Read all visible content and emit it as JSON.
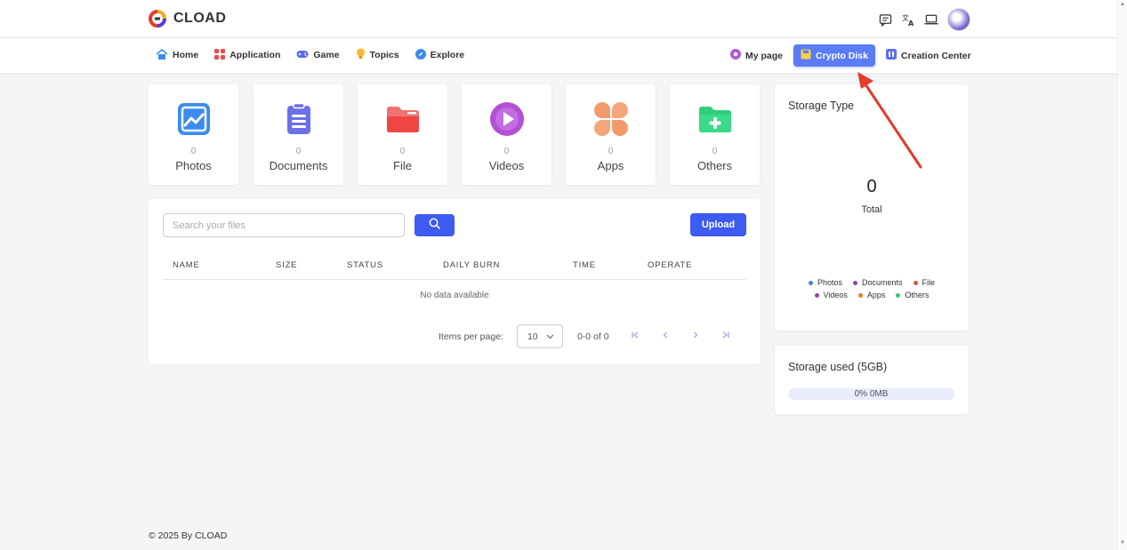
{
  "app": {
    "name": "CLOAD"
  },
  "header": {
    "icons": [
      "message-icon",
      "translate-icon",
      "laptop-icon",
      "avatar"
    ]
  },
  "nav": {
    "left": [
      {
        "label": "Home",
        "icon": "home-icon"
      },
      {
        "label": "Application",
        "icon": "apps-grid-icon"
      },
      {
        "label": "Game",
        "icon": "gamepad-icon"
      },
      {
        "label": "Topics",
        "icon": "bulb-icon"
      },
      {
        "label": "Explore",
        "icon": "compass-icon"
      }
    ],
    "right": [
      {
        "label": "My page",
        "icon": "flower-icon"
      },
      {
        "label": "Crypto Disk",
        "icon": "disk-icon",
        "active": true
      },
      {
        "label": "Creation Center",
        "icon": "grid-icon"
      }
    ]
  },
  "categories": [
    {
      "label": "Photos",
      "count": "0",
      "color": "#3b8bf0"
    },
    {
      "label": "Documents",
      "count": "0",
      "color": "#6b6fe8"
    },
    {
      "label": "File",
      "count": "0",
      "color": "#f05252"
    },
    {
      "label": "Videos",
      "count": "0",
      "color": "#b44fd6"
    },
    {
      "label": "Apps",
      "count": "0",
      "color": "#f29a6a"
    },
    {
      "label": "Others",
      "count": "0",
      "color": "#2fcf7a"
    }
  ],
  "files": {
    "search_placeholder": "Search your files",
    "upload_label": "Upload",
    "columns": [
      "NAME",
      "SIZE",
      "STATUS",
      "DAILY BURN",
      "TIME",
      "OPERATE"
    ],
    "empty_text": "No data available",
    "pager": {
      "items_per_page_label": "Items per page:",
      "per_page": "10",
      "range": "0-0 of 0"
    }
  },
  "storage_type": {
    "title": "Storage Type",
    "total": "0",
    "total_label": "Total",
    "legend": [
      {
        "label": "Photos",
        "color": "#4a80c8"
      },
      {
        "label": "Documents",
        "color": "#8e44ad"
      },
      {
        "label": "File",
        "color": "#e74c3c"
      },
      {
        "label": "Videos",
        "color": "#8e44ad"
      },
      {
        "label": "Apps",
        "color": "#e67e22"
      },
      {
        "label": "Others",
        "color": "#2ecc71"
      }
    ]
  },
  "storage_used": {
    "title": "Storage used (5GB)",
    "usage_text": "0% 0MB",
    "percent": 0
  },
  "footer": {
    "text": "© 2025 By CLOAD"
  },
  "colors": {
    "primary": "#3d5af1",
    "nav_active": "#5b7cf5",
    "annotation": "#e8392a"
  }
}
